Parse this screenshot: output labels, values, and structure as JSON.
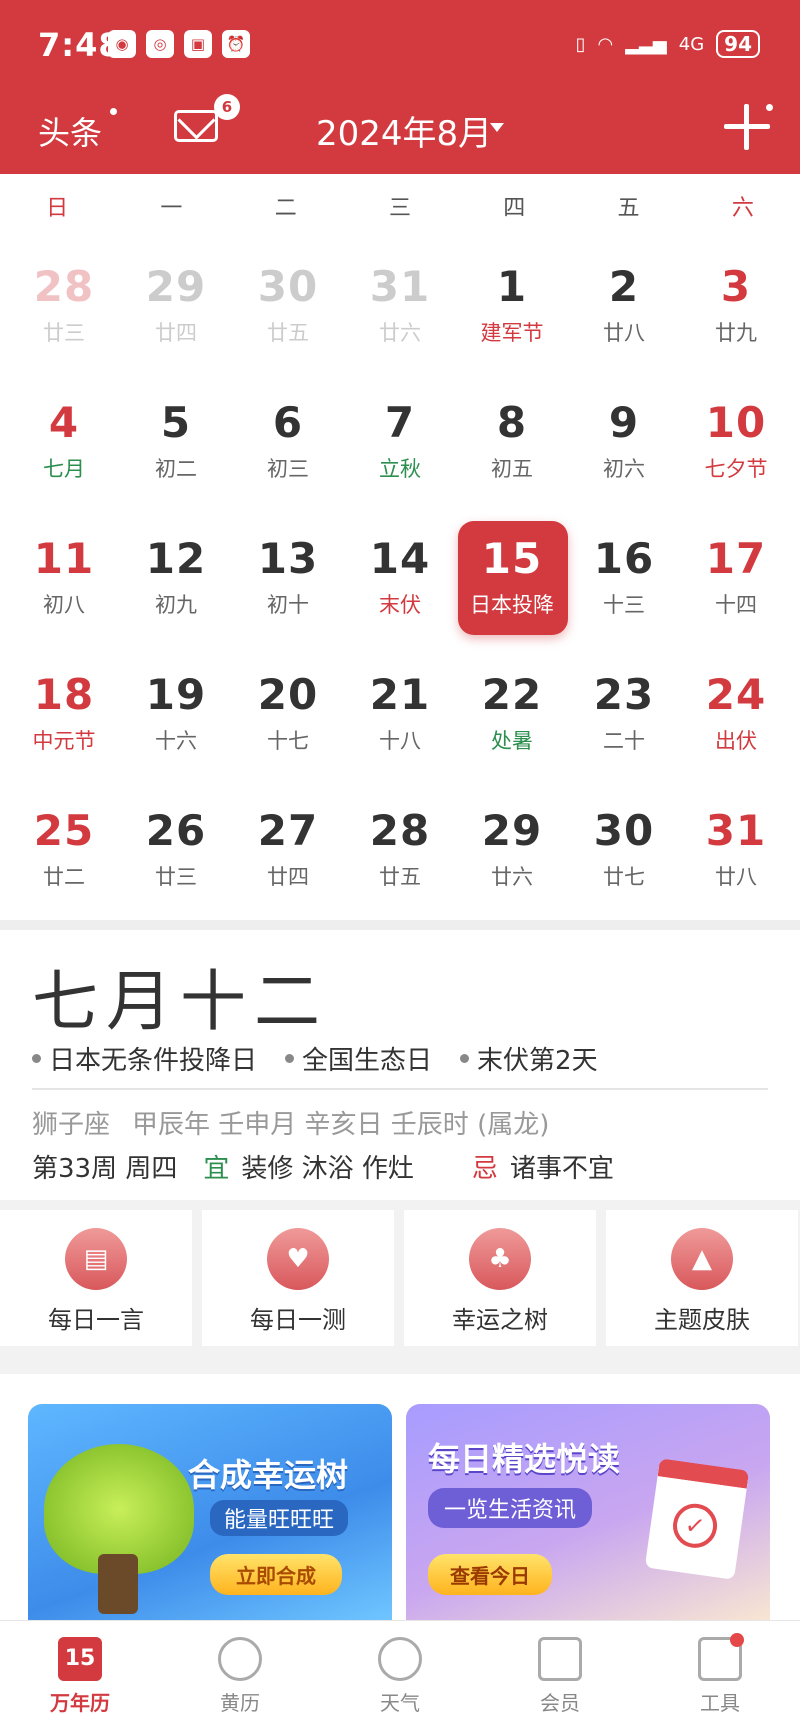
{
  "status": {
    "time": "7:48",
    "battery": "94",
    "network": "4G"
  },
  "header": {
    "toutiao": "头条",
    "mail_badge": "6",
    "month": "2024年8月"
  },
  "weekdays": [
    "日",
    "一",
    "二",
    "三",
    "四",
    "五",
    "六"
  ],
  "calendar": [
    [
      {
        "d": "28",
        "s": "廿三",
        "dim": true,
        "red": true
      },
      {
        "d": "29",
        "s": "廿四",
        "dim": true
      },
      {
        "d": "30",
        "s": "廿五",
        "dim": true
      },
      {
        "d": "31",
        "s": "廿六",
        "dim": true
      },
      {
        "d": "1",
        "s": "建军节",
        "sc": "red"
      },
      {
        "d": "2",
        "s": "廿八"
      },
      {
        "d": "3",
        "s": "廿九",
        "red": true
      }
    ],
    [
      {
        "d": "4",
        "s": "七月",
        "red": true,
        "sc": "green"
      },
      {
        "d": "5",
        "s": "初二"
      },
      {
        "d": "6",
        "s": "初三"
      },
      {
        "d": "7",
        "s": "立秋",
        "sc": "green"
      },
      {
        "d": "8",
        "s": "初五"
      },
      {
        "d": "9",
        "s": "初六"
      },
      {
        "d": "10",
        "s": "七夕节",
        "red": true,
        "sc": "red"
      }
    ],
    [
      {
        "d": "11",
        "s": "初八",
        "red": true
      },
      {
        "d": "12",
        "s": "初九"
      },
      {
        "d": "13",
        "s": "初十"
      },
      {
        "d": "14",
        "s": "末伏",
        "sc": "red"
      },
      {
        "d": "15",
        "s": "日本投降",
        "today": true
      },
      {
        "d": "16",
        "s": "十三"
      },
      {
        "d": "17",
        "s": "十四",
        "red": true
      }
    ],
    [
      {
        "d": "18",
        "s": "中元节",
        "red": true,
        "sc": "red"
      },
      {
        "d": "19",
        "s": "十六"
      },
      {
        "d": "20",
        "s": "十七"
      },
      {
        "d": "21",
        "s": "十八"
      },
      {
        "d": "22",
        "s": "处暑",
        "sc": "green"
      },
      {
        "d": "23",
        "s": "二十"
      },
      {
        "d": "24",
        "s": "出伏",
        "red": true,
        "sc": "red"
      }
    ],
    [
      {
        "d": "25",
        "s": "廿二",
        "red": true
      },
      {
        "d": "26",
        "s": "廿三"
      },
      {
        "d": "27",
        "s": "廿四"
      },
      {
        "d": "28",
        "s": "廿五"
      },
      {
        "d": "29",
        "s": "廿六"
      },
      {
        "d": "30",
        "s": "廿七"
      },
      {
        "d": "31",
        "s": "廿八",
        "red": true
      }
    ]
  ],
  "detail": {
    "lunar_date": "七月十二",
    "events": [
      "日本无条件投降日",
      "全国生态日",
      "末伏第2天"
    ],
    "ganzhi": [
      "狮子座",
      "甲辰年 壬申月 辛亥日 壬辰时 (属龙)"
    ],
    "week": "第33周 周四",
    "yi_label": "宜",
    "yi": "装修 沐浴 作灶",
    "ji_label": "忌",
    "ji": "诸事不宜"
  },
  "tools": [
    {
      "label": "每日一言",
      "icon": "note-icon"
    },
    {
      "label": "每日一测",
      "icon": "heart-pulse-icon"
    },
    {
      "label": "幸运之树",
      "icon": "tree-icon"
    },
    {
      "label": "主题皮肤",
      "icon": "shirt-icon"
    }
  ],
  "banners": {
    "tree": {
      "title": "合成幸运树",
      "subtitle": "能量旺旺旺",
      "button": "立即合成"
    },
    "read": {
      "title": "每日精选悦读",
      "subtitle": "一览生活资讯",
      "button": "查看今日"
    }
  },
  "bottom_nav": [
    {
      "label": "万年历",
      "icon": "calendar-icon",
      "badge": "15",
      "active": true
    },
    {
      "label": "黄历",
      "icon": "yin-yang-icon"
    },
    {
      "label": "天气",
      "icon": "weather-icon"
    },
    {
      "label": "会员",
      "icon": "crown-icon"
    },
    {
      "label": "工具",
      "icon": "grid-icon"
    }
  ],
  "colors": {
    "accent": "#d23a3f",
    "green": "#2d8f4f"
  }
}
